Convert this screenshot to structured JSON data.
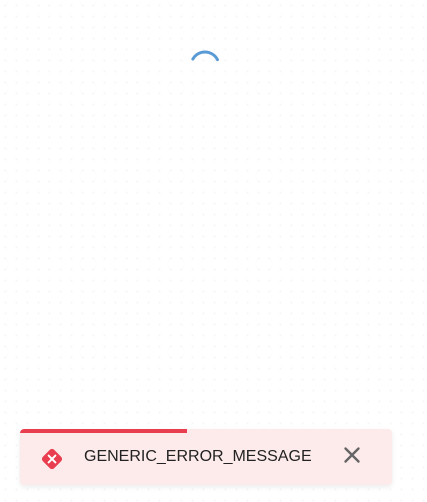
{
  "loader": {
    "icon": "loading-spinner-icon",
    "color": "#5b9bd5"
  },
  "toast": {
    "type": "error",
    "message": "GENERIC_ERROR_MESSAGE",
    "progress_percent": 45,
    "icon": "error-x-diamond-icon",
    "close_icon": "close-icon",
    "accent_color": "#e83e4f",
    "background_color": "#fdeaea"
  }
}
